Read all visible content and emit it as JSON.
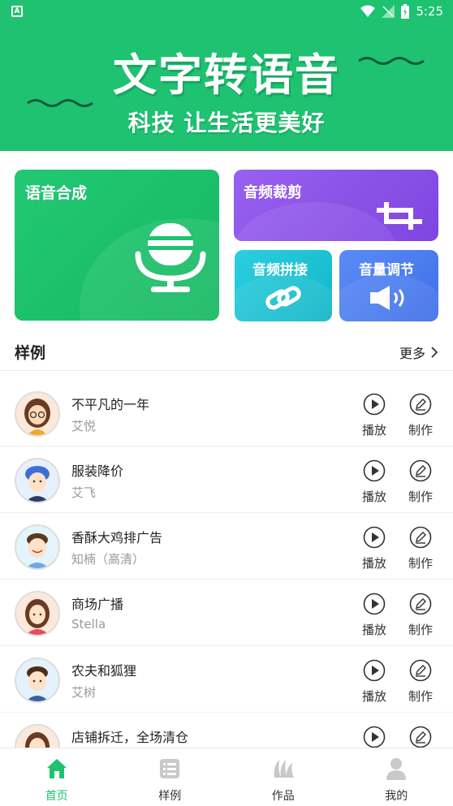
{
  "status_bar": {
    "time": "5:25",
    "left_icon": "A"
  },
  "banner": {
    "title": "文字转语音",
    "subtitle": "科技  让生活更美好"
  },
  "features": {
    "tts": {
      "label": "语音合成",
      "icon": "microphone-icon",
      "color": "#1ec271"
    },
    "crop": {
      "label": "音频裁剪",
      "icon": "crop-icon",
      "color": "#8f55e8"
    },
    "join": {
      "label": "音频拼接",
      "icon": "link-icon",
      "color": "#23c2d6"
    },
    "volume": {
      "label": "音量调节",
      "icon": "speaker-icon",
      "color": "#4a7ef0"
    }
  },
  "samples_section": {
    "title": "样例",
    "more_label": "更多"
  },
  "samples": [
    {
      "title": "不平凡的一年",
      "voice": "艾悦",
      "play_label": "播放",
      "make_label": "制作"
    },
    {
      "title": "服装降价",
      "voice": "艾飞",
      "play_label": "播放",
      "make_label": "制作"
    },
    {
      "title": "香酥大鸡排广告",
      "voice": "知楠（高清）",
      "play_label": "播放",
      "make_label": "制作"
    },
    {
      "title": "商场广播",
      "voice": "Stella",
      "play_label": "播放",
      "make_label": "制作"
    },
    {
      "title": "农夫和狐狸",
      "voice": "艾树",
      "play_label": "播放",
      "make_label": "制作"
    },
    {
      "title": "店铺拆迁，全场清仓",
      "voice": "",
      "play_label": "播放",
      "make_label": "制作"
    }
  ],
  "tabbar": {
    "home": {
      "label": "首页",
      "icon": "home-icon"
    },
    "samples": {
      "label": "样例",
      "icon": "list-icon"
    },
    "works": {
      "label": "作品",
      "icon": "works-icon"
    },
    "mine": {
      "label": "我的",
      "icon": "person-icon"
    }
  },
  "colors": {
    "brand": "#1ec271"
  }
}
